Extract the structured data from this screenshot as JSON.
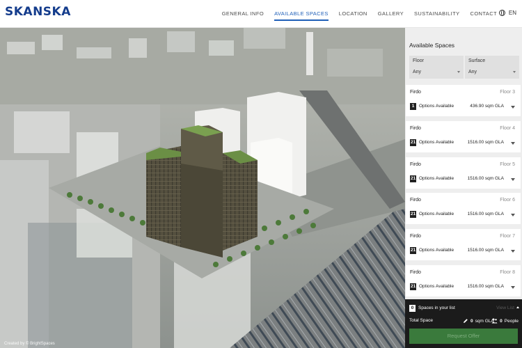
{
  "header": {
    "logo": "SKANSKA",
    "nav": [
      {
        "label": "GENERAL INFO"
      },
      {
        "label": "AVAILABLE SPACES"
      },
      {
        "label": "LOCATION"
      },
      {
        "label": "GALLERY"
      },
      {
        "label": "SUSTAINABILITY"
      },
      {
        "label": "CONTACT"
      }
    ],
    "language": "EN"
  },
  "map": {
    "credit": "Created by © BrightSpaces"
  },
  "panel": {
    "title": "Available Spaces",
    "filters": [
      {
        "label": "Floor",
        "value": "Any"
      },
      {
        "label": "Surface",
        "value": "Any"
      }
    ],
    "cards": [
      {
        "name": "Firdo",
        "floor": "Floor 3",
        "options_count": "1",
        "options_label": "Options Available",
        "area": "436.90 sqm GLA"
      },
      {
        "name": "Firdo",
        "floor": "Floor 4",
        "options_count": "21",
        "options_label": "Options Available",
        "area": "1516.00 sqm GLA"
      },
      {
        "name": "Firdo",
        "floor": "Floor 5",
        "options_count": "21",
        "options_label": "Options Available",
        "area": "1516.00 sqm GLA"
      },
      {
        "name": "Firdo",
        "floor": "Floor 6",
        "options_count": "21",
        "options_label": "Options Available",
        "area": "1516.00 sqm GLA"
      },
      {
        "name": "Firdo",
        "floor": "Floor 7",
        "options_count": "21",
        "options_label": "Options Available",
        "area": "1516.00 sqm GLA"
      },
      {
        "name": "Firdo",
        "floor": "Floor 8",
        "options_count": "21",
        "options_label": "Options Available",
        "area": "1516.00 sqm GLA"
      }
    ]
  },
  "summary": {
    "count": "0",
    "label": "Spaces in your list",
    "view_list": "View List",
    "total_label": "Total Space",
    "gla_value": "0",
    "gla_unit": "sqm GLA",
    "people_value": "0",
    "people_unit": "People",
    "button": "Request Offer"
  },
  "colors": {
    "brand": "#143c8c",
    "nav_active": "#1f5fb8",
    "button": "#3a7a3c"
  }
}
